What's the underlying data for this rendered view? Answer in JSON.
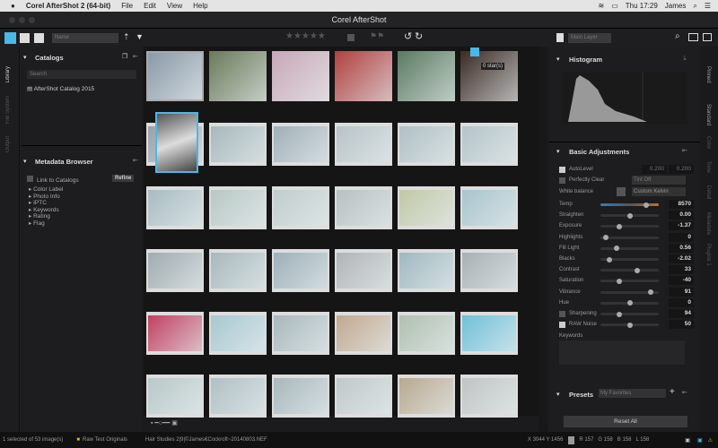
{
  "macbar": {
    "app": "Corel AfterShot 2 (64-bit)",
    "menus": [
      "File",
      "Edit",
      "View",
      "Help"
    ],
    "clock": "Thu 17:29",
    "user": "James"
  },
  "window_title": "Corel AfterShot",
  "toolbar": {
    "sort": "Name",
    "layer": "Main Layer",
    "rating_tooltip": "0 star(s)"
  },
  "left_tabs": [
    "Library",
    "File System",
    "Output"
  ],
  "catalogs": {
    "title": "Catalogs",
    "search_placeholder": "Search",
    "items": [
      "AfterShot Catalog 2015"
    ]
  },
  "metadata": {
    "title": "Metadata Browser",
    "link": "Link to Catalogs",
    "refine": "Refine",
    "items": [
      "Color Label",
      "Photo Info",
      "IPTC",
      "Keywords",
      "Rating",
      "Flag"
    ]
  },
  "right_tabs": [
    "Pinned",
    "Standard",
    "Color",
    "Tone",
    "Detail",
    "Metadata",
    "Plugins 1"
  ],
  "histogram": {
    "title": "Histogram"
  },
  "basic": {
    "title": "Basic Adjustments",
    "autolevel": "AutoLevel",
    "al1": "0.200",
    "al2": "0.200",
    "perfectly_clear": "Perfectly Clear",
    "tint": "Tint Off",
    "wb": "White balance",
    "wb_value": "Custom Kelvin",
    "sliders": [
      {
        "label": "Temp",
        "value": "8570",
        "pos": 0.82
      },
      {
        "label": "Straighten",
        "value": "0.00",
        "pos": 0.5
      },
      {
        "label": "Exposure",
        "value": "-1.37",
        "pos": 0.3
      },
      {
        "label": "Highlights",
        "value": "0",
        "pos": 0.05
      },
      {
        "label": "Fill Light",
        "value": "0.56",
        "pos": 0.25
      },
      {
        "label": "Blacks",
        "value": "-2.02",
        "pos": 0.12
      },
      {
        "label": "Contrast",
        "value": "33",
        "pos": 0.65
      },
      {
        "label": "Saturation",
        "value": "-40",
        "pos": 0.3
      },
      {
        "label": "Vibrance",
        "value": "91",
        "pos": 0.9
      },
      {
        "label": "Hue",
        "value": "0",
        "pos": 0.5
      },
      {
        "label": "Sharpening",
        "value": "94",
        "pos": 0.3
      },
      {
        "label": "RAW Noise",
        "value": "50",
        "pos": 0.5
      }
    ],
    "keywords": "Keywords"
  },
  "presets": {
    "title": "Presets",
    "value": "My Favorites"
  },
  "reset": "Reset All",
  "status": {
    "selection": "1 selected of 53 image(s)",
    "folder": "Raw Test Originals",
    "file": "Hair Studies 2|9|©James€Cockroft~20140803.NEF",
    "coords": "X 3044  Y 1456",
    "r": "R 157",
    "g": "G 158",
    "b": "B 158",
    "l": "L 158"
  },
  "thumbnails": [
    "#8a9aa8",
    "#6a7a5a",
    "#c8a8b8",
    "#b04040",
    "#5a7a60",
    "#3a2a24",
    "#9aa0a8",
    "#a8b8bc",
    "#a0b0b8",
    "#b8c4c8",
    "#b0c0c4",
    "#b4c4c8",
    "#a8bcc0",
    "#b8c8c4",
    "#c0cccc",
    "#b8c0c0",
    "#c0c8a8",
    "#a8c4cc",
    "#a0acb0",
    "#a8b8bc",
    "#9cb0b8",
    "#b0b4b8",
    "#a0b8c0",
    "#a8b0b4",
    "#c04060",
    "#a8c8d0",
    "#a8b8bc",
    "#c0a890",
    "#b0c0b0",
    "#70c0d8",
    "#b8c8c8",
    "#b0c0c4",
    "#a8b8bc",
    "#c0c8c8",
    "#b8a890",
    "#c0c4c4"
  ]
}
